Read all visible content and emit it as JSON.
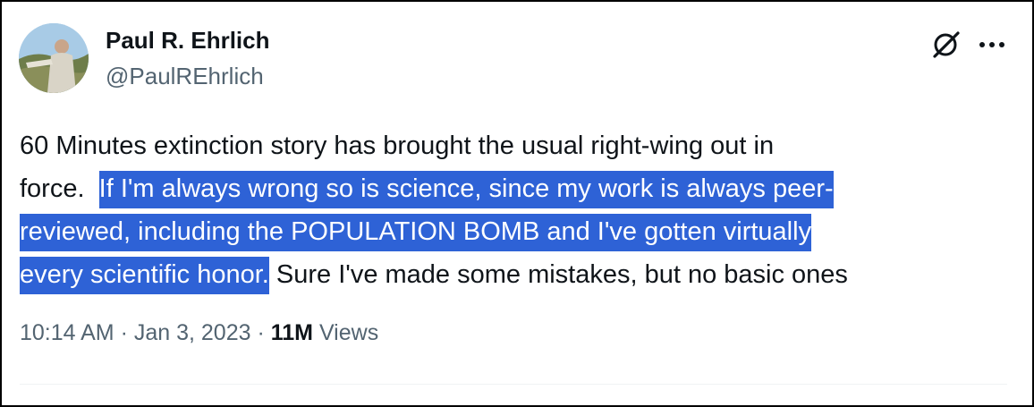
{
  "author": {
    "name": "Paul R. Ehrlich",
    "handle": "@PaulREhrlich"
  },
  "tweet": {
    "line1": "60 Minutes extinction story has brought the usual right-wing out in",
    "line2_plain": "force.  ",
    "line2_highlight": "If I'm always wrong so is science, since my work is always peer-",
    "line3_highlight": "reviewed, including the POPULATION BOMB and I've gotten virtually",
    "line4_highlight": "every scientific honor.",
    "line4_plain": " Sure I've made some mistakes, but no basic ones"
  },
  "meta": {
    "time": "10:14 AM",
    "sep1": " · ",
    "date": "Jan 3, 2023",
    "sep2": " · ",
    "views_count": "11M",
    "views_label": " Views"
  },
  "icons": {
    "grok": "grok-icon",
    "more": "more-dots-icon"
  },
  "colors": {
    "name": "#0f1419",
    "secondary": "#536471",
    "selection_highlight": "#2e62d6"
  }
}
